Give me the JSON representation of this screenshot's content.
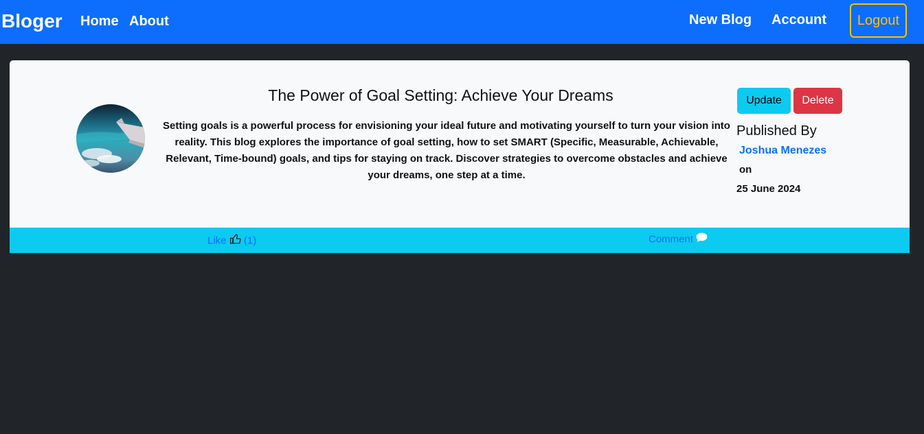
{
  "navbar": {
    "brand": "Bloger",
    "links": {
      "home": "Home",
      "about": "About",
      "new_blog": "New Blog",
      "account": "Account"
    },
    "logout_label": "Logout"
  },
  "post": {
    "title": "The Power of Goal Setting: Achieve Your Dreams",
    "content": "Setting goals is a powerful process for envisioning your ideal future and motivating yourself to turn your vision into reality. This blog explores the importance of goal setting, how to set SMART (Specific, Measurable, Achievable, Relevant, Time-bound) goals, and tips for staying on track. Discover strategies to overcome obstacles and achieve your dreams, one step at a time.",
    "update_label": "Update",
    "delete_label": "Delete",
    "published_by_label": "Published By",
    "author": "Joshua Menezes",
    "on_label": "on",
    "date": "25 June 2024",
    "like_label": "Like",
    "like_count": "(1)",
    "comment_label": "Comment"
  },
  "icons": {
    "like": "thumbs-up-icon",
    "comment": "chat-bubble-icon"
  },
  "colors": {
    "navbar_bg": "#0d6efd",
    "page_bg": "#212529",
    "card_bg": "#f8f9fa",
    "footer_bg": "#0dcaf0",
    "update_bg": "#0dcaf0",
    "delete_bg": "#dc3545",
    "logout_border": "#ffc107",
    "link": "#0d6efd"
  }
}
